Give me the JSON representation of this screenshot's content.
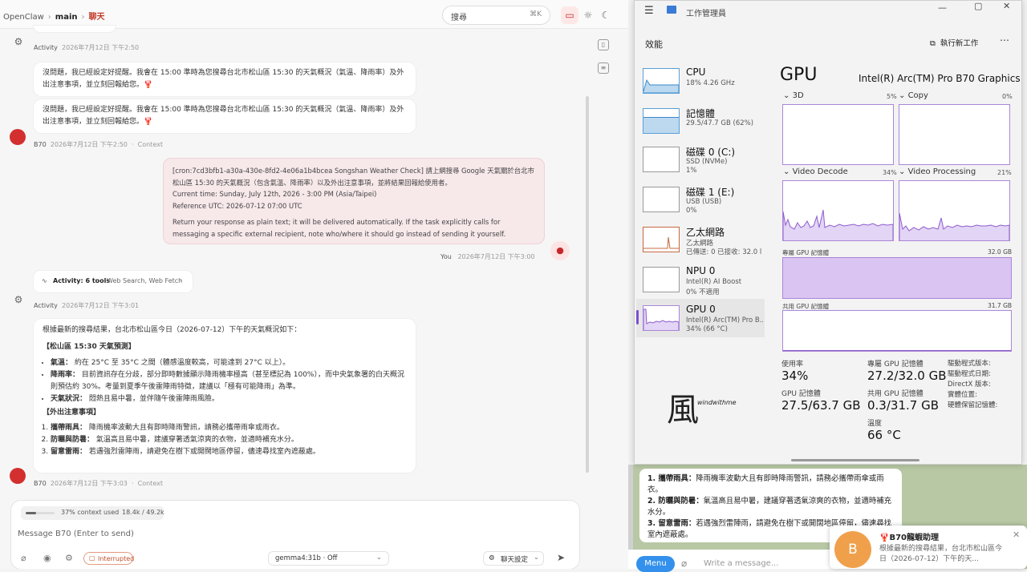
{
  "chat": {
    "breadcrumb": {
      "app": "OpenClaw",
      "agent": "main",
      "current": "聊天"
    },
    "search": {
      "label": "搜尋",
      "shortcut": "⌘K"
    },
    "activity_meta": {
      "label": "Activity",
      "time1": "2026年7月12日 下午2:50",
      "time2": "2026年7月12日 下午3:01"
    },
    "reminder_text": "沒問題，我已經設定好提醒。我會在 15:00 準時為您搜尋台北市松山區 15:30 的天氣概況（氣溫、降雨率）及外出注意事項，並立刻回報給您。🦞",
    "bot_meta": {
      "name": "B70",
      "time1": "2026年7月12日 下午2:50",
      "time2": "2026年7月12日 下午3:03",
      "context": "Context"
    },
    "user_msg": {
      "line1": "[cron:7cd3bfb1-a30a-430e-8fd2-4e06a1b4bcea Songshan Weather Check] 請上網搜尋 Google 天氣關於台北市松山區 15:30 的天氣概況（包含氣溫、降雨率）以及外出注意事項，並將結果回報給使用者。",
      "line2": "Current time: Sunday, July 12th, 2026 - 3:00 PM (Asia/Taipei)",
      "line3": "Reference UTC: 2026-07-12 07:00 UTC",
      "line4": "Return your response as plain text; it will be delivered automatically. If the task explicitly calls for messaging a specific external recipient, note who/where it should go instead of sending it yourself."
    },
    "user_meta": {
      "name": "You",
      "time": "2026年7月12日 下午3:00"
    },
    "activity_tools": {
      "label": "Activity: 6 tools",
      "tools": "Web Search, Web Fetch"
    },
    "answer": {
      "intro": "根據最新的搜尋結果，台北市松山區今日（2026-07-12）下午的天氣概況如下：",
      "h1": "【松山區 15:30 天氣預測】",
      "b1_label": "氣溫：",
      "b1_text": "約在 25°C 至 35°C 之間（體感溫度較高，可能達到 27°C 以上）。",
      "b2_label": "降雨率：",
      "b2_text": "目前資訊存在分歧，部分即時數據顯示降雨機率極高（甚至標記為 100%），而中央氣象署的白天概況則預估約 30%。考量到夏季午後雷陣雨特徵，建議以「極有可能降雨」為準。",
      "b3_label": "天氣狀況：",
      "b3_text": "悶熱且易中暑，並伴隨午後雷陣雨風險。",
      "h2": "【外出注意事項】",
      "o1_label": "攜帶雨具：",
      "o1_text": "降雨機率波動大且有即時降雨警訊，請務必攜帶雨傘或雨衣。",
      "o2_label": "防曬與防暑：",
      "o2_text": "氣溫高且易中暑，建議穿著透氣涼爽的衣物，並適時補充水分。",
      "o3_label": "留意雷雨：",
      "o3_text": "若遇強烈雷陣雨，請避免在樹下或開闊地區停留，儘速尋找室內遮蔽處。"
    },
    "composer": {
      "context_text": "37% context used",
      "context_nums": "18.4k / 49.2k",
      "context_fraction": 0.37,
      "placeholder": "Message B70 (Enter to send)",
      "interrupted": "Interrupted",
      "model": "gemma4:31b · Off",
      "settings": "聊天設定"
    }
  },
  "taskmgr": {
    "title": "工作管理員",
    "section": "效能",
    "run_new": "執行新工作",
    "nav": [
      {
        "name": "CPU",
        "l2": "18% 4.26 GHz",
        "l3": ""
      },
      {
        "name": "記憶體",
        "l2": "29.5/47.7 GB (62%)",
        "l3": ""
      },
      {
        "name": "磁碟 0 (C:)",
        "l2": "SSD (NVMe)",
        "l3": "1%"
      },
      {
        "name": "磁碟 1 (E:)",
        "l2": "USB (USB)",
        "l3": "0%"
      },
      {
        "name": "乙太網路",
        "l2": "乙太網路",
        "l3": "已傳送: 0 已接收: 32.0 l"
      },
      {
        "name": "NPU 0",
        "l2": "Intel(R) AI Boost",
        "l3": "0% 不適用"
      },
      {
        "name": "GPU 0",
        "l2": "Intel(R) Arc(TM) Pro B...",
        "l3": "34% (66 °C)"
      }
    ],
    "gpu_title": "GPU",
    "gpu_name": "Intel(R) Arc(TM) Pro B70 Graphics",
    "engines": [
      {
        "name": "3D",
        "pct": "5%"
      },
      {
        "name": "Copy",
        "pct": "0%"
      },
      {
        "name": "Video Decode",
        "pct": "34%"
      },
      {
        "name": "Video Processing",
        "pct": "21%"
      }
    ],
    "dedicated_label": "專屬 GPU 記憶體",
    "dedicated_max": "32.0 GB",
    "shared_label": "共用 GPU 記憶體",
    "shared_max": "31.7 GB",
    "stats": {
      "usage_l": "使用率",
      "usage_v": "34%",
      "ded_l": "專屬 GPU 記憶體",
      "ded_v": "27.2/32.0 GB",
      "gpu_mem_l": "GPU 記憶體",
      "gpu_mem_v": "27.5/63.7 GB",
      "shared_l": "共用 GPU 記憶體",
      "shared_v": "0.3/31.7 GB",
      "temp_l": "溫度",
      "temp_v": "66 °C"
    },
    "driver": [
      "驅動程式版本:",
      "驅動程式日期:",
      "DirectX 版本:",
      "實體位置:",
      "硬體保留記憶體:"
    ],
    "watermark": "windwithme",
    "watermark_glyph": "風"
  },
  "telegram": {
    "items": [
      {
        "label": "1. 攜帶雨具：",
        "text": "降雨機率波動大且有即時降雨警訊，請務必攜帶雨傘或雨衣。"
      },
      {
        "label": "2. 防曬與防暑：",
        "text": "氣溫高且易中暑，建議穿著透氣涼爽的衣物，並適時補充水分。"
      },
      {
        "label": "3. 留意雷雨：",
        "text": "若遇強烈雷陣雨，請避免在樹下或開闊地區停留，儘速尋找室內遮蔽處。"
      }
    ],
    "menu": "Menu",
    "input_placeholder": "Write a message...",
    "notif_title": "🦞B70龍蝦助理",
    "notif_text": "根據最新的搜尋結果，台北市松山區今日（2026-07-12）下午的天...",
    "notif_initial": "B"
  }
}
